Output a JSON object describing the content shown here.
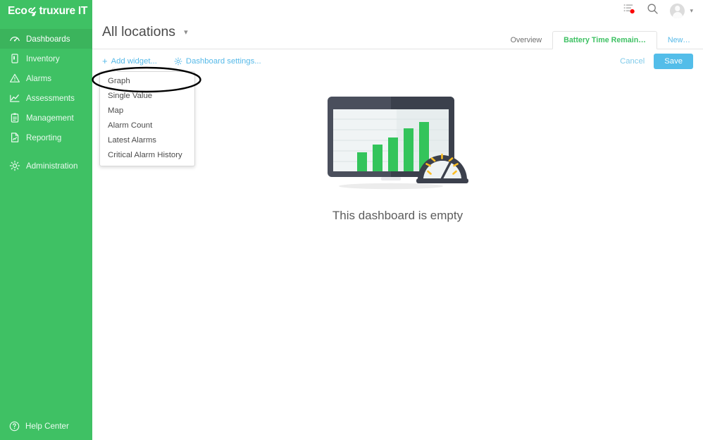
{
  "brand": {
    "logo_text_prefix": "Eco",
    "logo_text_suffix": "truxure IT",
    "logo_mark": "s-link-icon",
    "green": "#3fc164",
    "green_active": "#3bb45c",
    "blue": "#56b9e8",
    "save_blue": "#53bde9"
  },
  "sidebar": {
    "items": [
      {
        "label": "Dashboards",
        "icon": "gauge-icon",
        "active": true
      },
      {
        "label": "Inventory",
        "icon": "server-icon",
        "active": false
      },
      {
        "label": "Alarms",
        "icon": "warning-triangle-icon",
        "active": false
      },
      {
        "label": "Assessments",
        "icon": "trend-chart-icon",
        "active": false
      },
      {
        "label": "Management",
        "icon": "clipboard-icon",
        "active": false
      },
      {
        "label": "Reporting",
        "icon": "report-doc-icon",
        "active": false
      },
      {
        "label": "Administration",
        "icon": "gear-icon",
        "active": false
      }
    ],
    "help_center": {
      "label": "Help Center",
      "icon": "question-circle-icon"
    }
  },
  "topbar": {
    "notifications_icon": "list-notification-icon",
    "notifications_badge": true,
    "search_icon": "search-icon",
    "avatar_icon": "avatar-icon",
    "avatar_chevron": "chevron-down-icon"
  },
  "header": {
    "title": "All locations",
    "title_chevron": "chevron-down-icon"
  },
  "tabs": [
    {
      "label": "Overview",
      "state": "inactive"
    },
    {
      "label": "Battery Time Remain…",
      "state": "active"
    },
    {
      "label": "New…",
      "state": "new"
    }
  ],
  "toolbar": {
    "add_widget_label": "Add widget...",
    "add_widget_icon": "plus-icon",
    "dashboard_settings_label": "Dashboard settings...",
    "dashboard_settings_icon": "gear-icon",
    "cancel_label": "Cancel",
    "save_label": "Save"
  },
  "widget_menu": {
    "open": true,
    "items": [
      {
        "label": "Graph",
        "highlighted": true
      },
      {
        "label": "Single Value",
        "highlighted": false
      },
      {
        "label": "Map",
        "highlighted": false
      },
      {
        "label": "Alarm Count",
        "highlighted": false
      },
      {
        "label": "Latest Alarms",
        "highlighted": false
      },
      {
        "label": "Critical Alarm History",
        "highlighted": false
      }
    ]
  },
  "annotation": {
    "shape": "ellipse",
    "color": "#000000",
    "target": "Graph"
  },
  "empty_state": {
    "message": "This dashboard is empty",
    "illustration": "monitor-bar-chart-gauge-icon",
    "bar_count": 5,
    "gauge_ticks": 7
  }
}
